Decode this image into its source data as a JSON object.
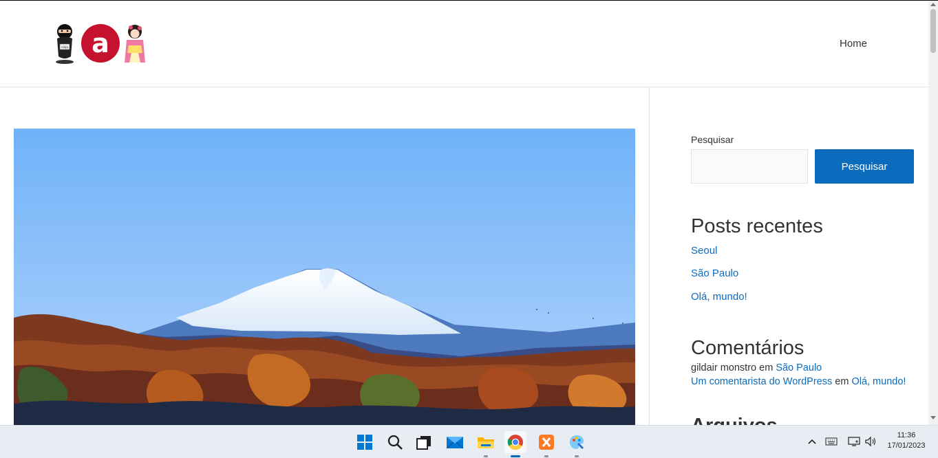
{
  "site": {
    "nav": {
      "home": "Home"
    },
    "logo": {
      "name": "site logo",
      "badge_letter": "a",
      "ninja_label": "ninja"
    }
  },
  "sidebar": {
    "search": {
      "label": "Pesquisar",
      "placeholder": "",
      "button": "Pesquisar"
    },
    "recent_posts": {
      "title": "Posts recentes",
      "items": [
        "Seoul",
        "São Paulo",
        "Olá, mundo!"
      ]
    },
    "comments": {
      "title": "Comentários",
      "items": [
        {
          "author": "gildair monstro",
          "connector": "em",
          "post": "São Paulo"
        },
        {
          "author": "Um comentarista do WordPress",
          "connector": "em",
          "post": "Olá, mundo!"
        }
      ]
    },
    "next_widget_title": "Arquivos"
  },
  "colors": {
    "accent": "#0b6bbd",
    "text": "#333333",
    "taskbar": "#e8edf3"
  },
  "taskbar": {
    "icons": [
      "windows-start-icon",
      "search-icon",
      "task-view-icon",
      "mail-icon",
      "file-explorer-icon",
      "chrome-icon",
      "xampp-icon",
      "paint-icon"
    ],
    "clock": {
      "time": "11:36",
      "date": "17/01/2023"
    }
  }
}
